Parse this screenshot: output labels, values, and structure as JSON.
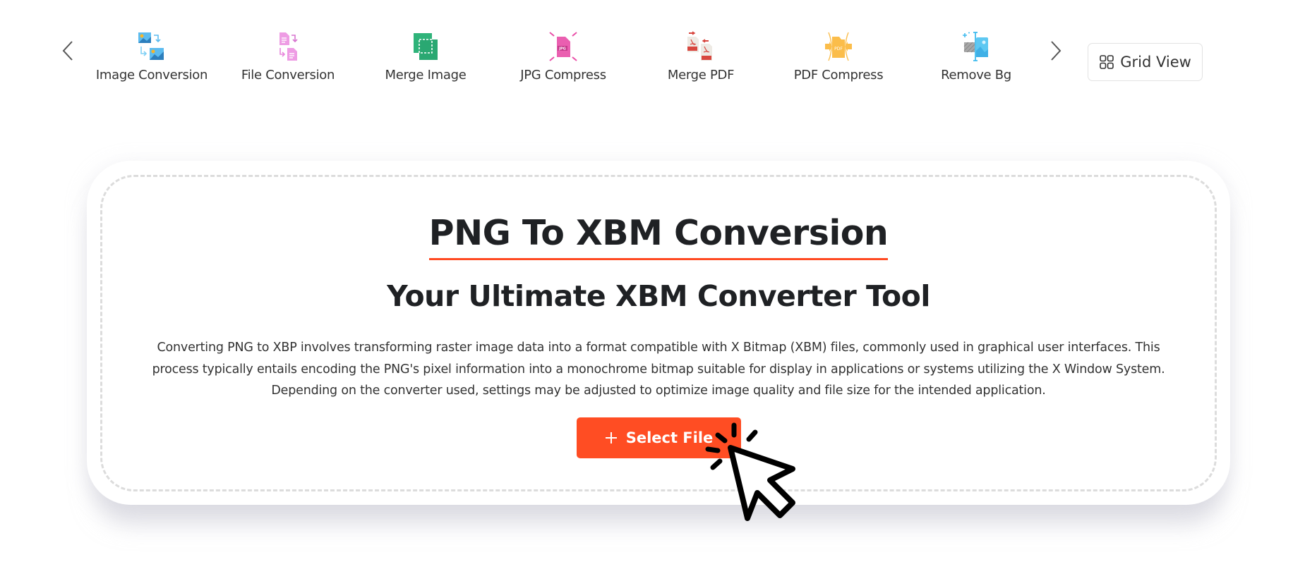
{
  "nav": {
    "prev_icon": "chevron-left-icon",
    "next_icon": "chevron-right-icon",
    "items": [
      {
        "label": "Image Conversion",
        "icon": "image-conversion-icon",
        "color": "#4fb4ec"
      },
      {
        "label": "File Conversion",
        "icon": "file-conversion-icon",
        "color": "#e887dc"
      },
      {
        "label": "Merge Image",
        "icon": "merge-image-icon",
        "color": "#2fb37a"
      },
      {
        "label": "JPG Compress",
        "icon": "jpg-compress-icon",
        "color": "#ea4fa8"
      },
      {
        "label": "Merge PDF",
        "icon": "merge-pdf-icon",
        "color": "#d8473f"
      },
      {
        "label": "PDF Compress",
        "icon": "pdf-compress-icon",
        "color": "#fbbd4a"
      },
      {
        "label": "Remove Bg",
        "icon": "remove-bg-icon",
        "color": "#3fbbee"
      }
    ],
    "grid_view_label": "Grid View",
    "grid_view_icon": "grid-icon"
  },
  "main": {
    "title": "PNG To XBM Conversion",
    "subtitle": "Your Ultimate XBM Converter Tool",
    "description": "Converting PNG to XBP involves transforming raster image data into a format compatible with X Bitmap (XBM) files, commonly used in graphical user interfaces. This process typically entails encoding the PNG's pixel information into a monochrome bitmap suitable for display in applications or systems utilizing the X Window System. Depending on the converter used, settings may be adjusted to optimize image quality and file size for the intended application.",
    "select_file_label": "Select File",
    "select_file_icon": "plus-icon"
  },
  "colors": {
    "accent": "#ff4d23",
    "title_underline": "#ff4a22",
    "text_dark": "#1f2124",
    "dashed_border": "#dcdcdc"
  }
}
